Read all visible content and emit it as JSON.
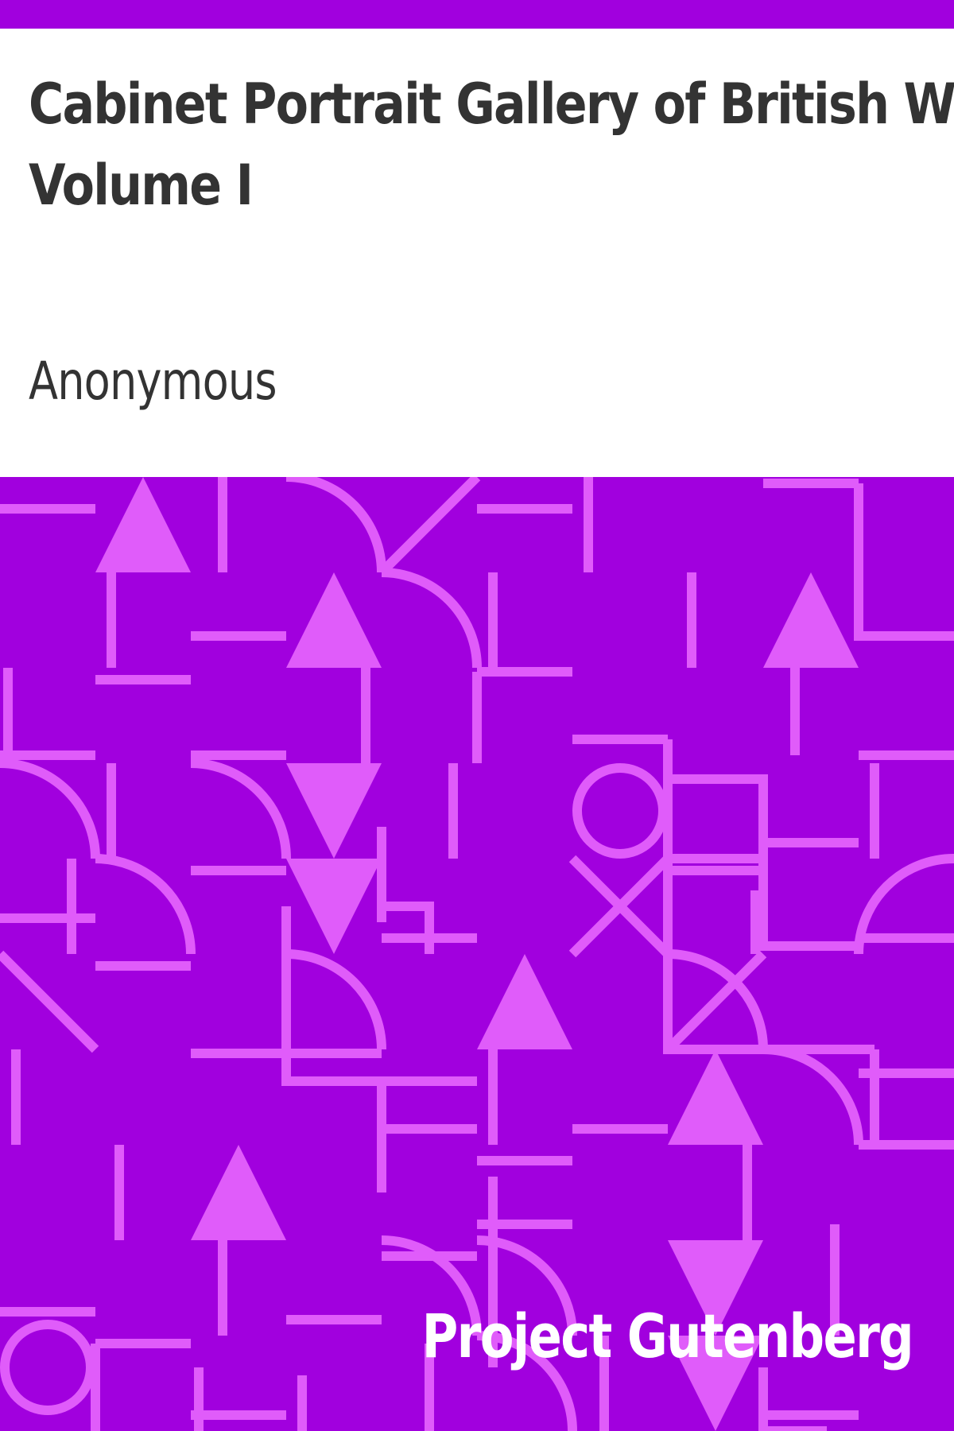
{
  "colors": {
    "background": "#a100de",
    "pattern": "#e05cfa",
    "page": "#ffffff",
    "text": "#333333",
    "publisher_text": "#ffffff"
  },
  "book": {
    "title_line1": "Cabinet Portrait Gallery of British Worthies.",
    "title_line2": "Volume I",
    "author": "Anonymous",
    "publisher": "Project Gutenberg"
  }
}
